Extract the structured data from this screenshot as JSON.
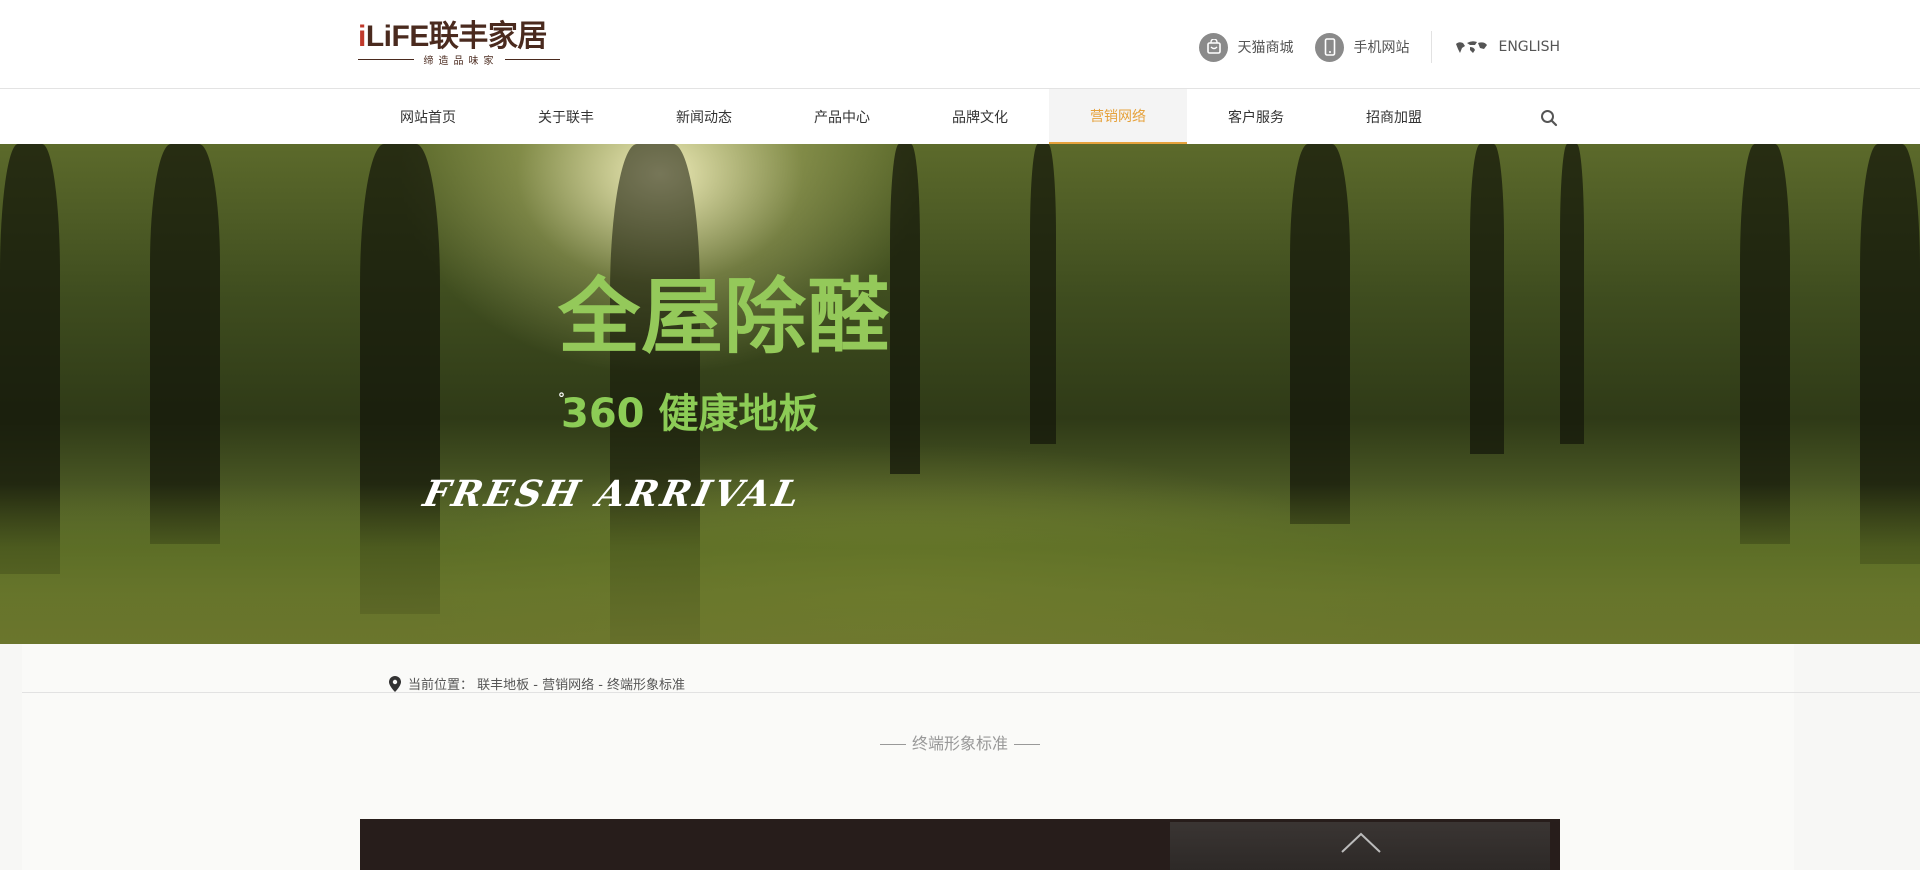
{
  "brand": {
    "logo_main_prefix": "i",
    "logo_main_rest": "LiFE联丰家居",
    "logo_tagline": "缔造品味家"
  },
  "top_links": [
    {
      "label": "天猫商城",
      "icon": "tmall-bag-icon"
    },
    {
      "label": "手机网站",
      "icon": "mobile-phone-icon"
    },
    {
      "label": "ENGLISH",
      "icon": "world-map-icon"
    }
  ],
  "nav": {
    "items": [
      {
        "label": "网站首页",
        "active": false
      },
      {
        "label": "关于联丰",
        "active": false
      },
      {
        "label": "新闻动态",
        "active": false
      },
      {
        "label": "产品中心",
        "active": false
      },
      {
        "label": "品牌文化",
        "active": false
      },
      {
        "label": "营销网络",
        "active": true
      },
      {
        "label": "客户服务",
        "active": false
      },
      {
        "label": "招商加盟",
        "active": false
      }
    ],
    "active_color": "#e6a23c",
    "search_icon": "search-icon"
  },
  "banner": {
    "title": "全屋除醛",
    "subtitle_degree": "°",
    "subtitle": "360 健康地板",
    "script_text": "FRESH ARRIVAL",
    "title_color": "#94c95a"
  },
  "breadcrumb": {
    "icon": "location-pin-icon",
    "text": "当前位置： 联丰地板 - 营销网络 - 终端形象标准"
  },
  "section": {
    "title": "终端形象标准"
  },
  "back_to_top_icon": "chevron-up-icon"
}
